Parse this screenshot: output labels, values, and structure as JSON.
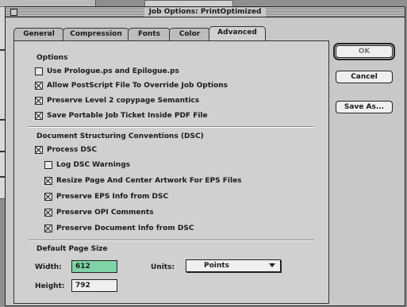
{
  "window": {
    "title": "Job Options: PrintOptimized"
  },
  "tabs": [
    {
      "label": "General"
    },
    {
      "label": "Compression"
    },
    {
      "label": "Fonts"
    },
    {
      "label": "Color"
    },
    {
      "label": "Advanced"
    }
  ],
  "active_tab": "Advanced",
  "options": {
    "title": "Options",
    "items": [
      {
        "label": "Use Prologue.ps and Epilogue.ps",
        "checked": false
      },
      {
        "label": "Allow PostScript File To Override Job Options",
        "checked": true
      },
      {
        "label": "Preserve Level 2 copypage Semantics",
        "checked": true
      },
      {
        "label": "Save Portable Job Ticket Inside PDF File",
        "checked": true
      }
    ]
  },
  "dsc": {
    "title": "Document Structuring Conventions (DSC)",
    "process": {
      "label": "Process DSC",
      "checked": true
    },
    "items": [
      {
        "label": "Log DSC Warnings",
        "checked": false
      },
      {
        "label": "Resize Page And Center Artwork For EPS Files",
        "checked": true
      },
      {
        "label": "Preserve EPS Info from DSC",
        "checked": true
      },
      {
        "label": "Preserve OPI Comments",
        "checked": true
      },
      {
        "label": "Preserve Document Info from DSC",
        "checked": true
      }
    ]
  },
  "page_size": {
    "title": "Default Page Size",
    "width_label": "Width:",
    "width_value": "612",
    "height_label": "Height:",
    "height_value": "792",
    "units_label": "Units:",
    "units_value": "Points"
  },
  "buttons": {
    "ok": "OK",
    "cancel": "Cancel",
    "save_as": "Save As..."
  }
}
